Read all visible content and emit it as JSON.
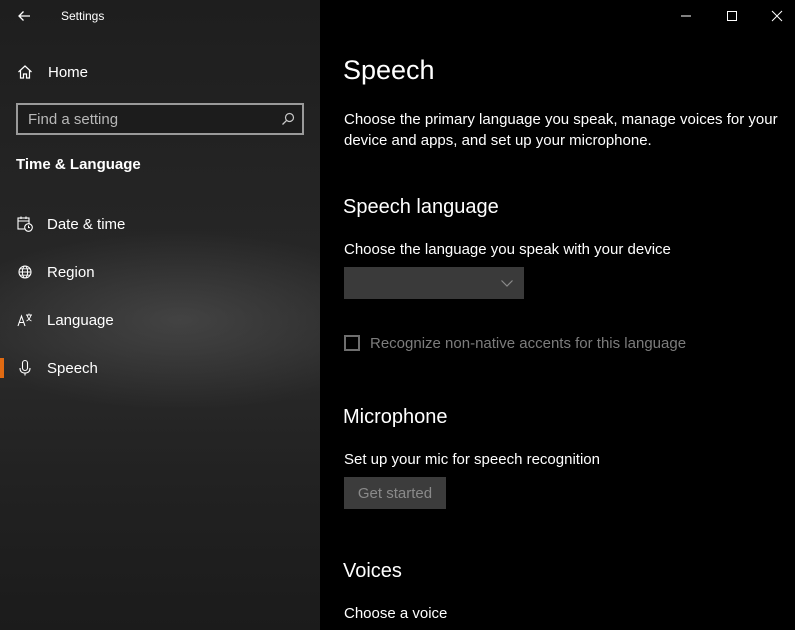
{
  "window": {
    "title": "Settings",
    "controls": [
      "minimize-icon",
      "maximize-icon",
      "close-icon"
    ]
  },
  "sidebar": {
    "home_label": "Home",
    "search": {
      "placeholder": "Find a setting",
      "value": ""
    },
    "section_header": "Time & Language",
    "items": [
      {
        "label": "Date & time",
        "icon": "calendar-clock-icon",
        "selected": false
      },
      {
        "label": "Region",
        "icon": "globe-icon",
        "selected": false
      },
      {
        "label": "Language",
        "icon": "language-icon",
        "selected": false
      },
      {
        "label": "Speech",
        "icon": "microphone-icon",
        "selected": true
      }
    ]
  },
  "main": {
    "title": "Speech",
    "description": "Choose the primary language you speak, manage voices for your device and apps, and set up your microphone.",
    "speech_language": {
      "heading": "Speech language",
      "label": "Choose the language you speak with your device",
      "dropdown_value": "",
      "checkbox_label": "Recognize non-native accents for this language",
      "checkbox_checked": false
    },
    "microphone": {
      "heading": "Microphone",
      "label": "Set up your mic for speech recognition",
      "button_label": "Get started"
    },
    "voices": {
      "heading": "Voices",
      "label": "Choose a voice"
    }
  },
  "colors": {
    "accent": "#e06a12",
    "main_background": "#000000",
    "disabled_text": "#7c7c7c"
  }
}
